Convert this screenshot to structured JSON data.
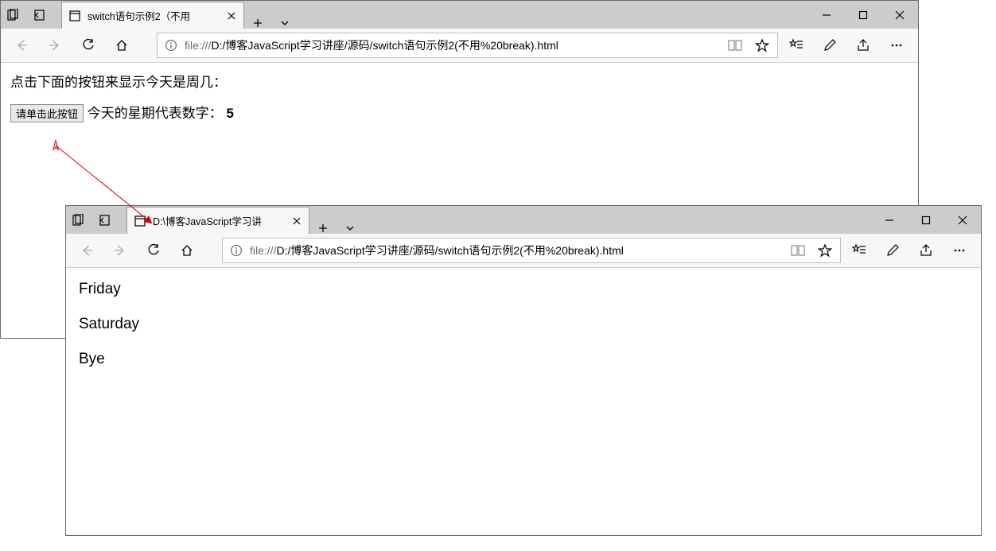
{
  "window1": {
    "tab_title": "switch语句示例2（不用",
    "url_proto": "file:///",
    "url_path": "D:/博客JavaScript学习讲座/源码/switch语句示例2(不用%20break).html",
    "content": {
      "instruction": "点击下面的按钮来显示今天是周几：",
      "button_label": "请单击此按钮",
      "result_label": "今天的星期代表数字：",
      "result_value": "5"
    }
  },
  "window2": {
    "tab_title": "D:\\博客JavaScript学习讲",
    "url_proto": "file:///",
    "url_path": "D:/博客JavaScript学习讲座/源码/switch语句示例2(不用%20break).html",
    "content": {
      "line1": "Friday",
      "line2": "Saturday",
      "line3": "Bye"
    }
  }
}
